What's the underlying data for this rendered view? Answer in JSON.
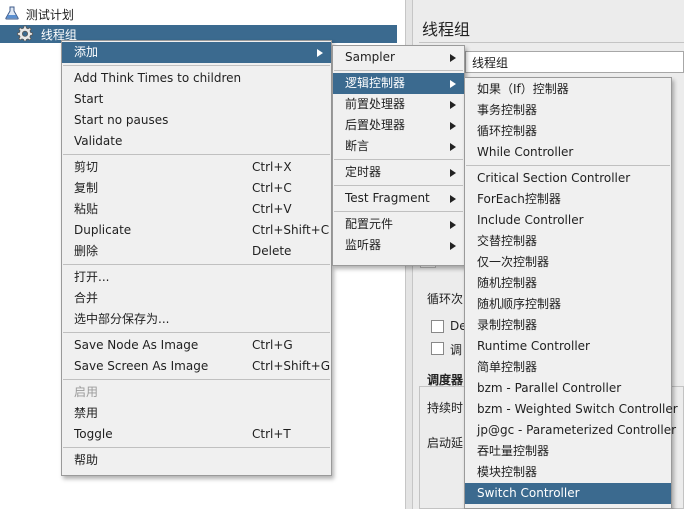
{
  "tree": {
    "test_plan": "测试计划",
    "thread_group": "线程组"
  },
  "editor": {
    "title": "线程组",
    "name_value": "线程组",
    "loop_label": "循环次",
    "check1_label": "De",
    "check2_label": "调",
    "scheduler_label": "调度器",
    "duration_label": "持续时",
    "startup_delay_label": "启动延"
  },
  "context_menu": {
    "items": [
      {
        "label": "添加",
        "submenu": true
      },
      {
        "sep": true
      },
      {
        "label": "Add Think Times to children"
      },
      {
        "label": "Start"
      },
      {
        "label": "Start no pauses"
      },
      {
        "label": "Validate"
      },
      {
        "sep": true
      },
      {
        "label": "剪切",
        "shortcut": "Ctrl+X"
      },
      {
        "label": "复制",
        "shortcut": "Ctrl+C"
      },
      {
        "label": "粘贴",
        "shortcut": "Ctrl+V"
      },
      {
        "label": "Duplicate",
        "shortcut": "Ctrl+Shift+C"
      },
      {
        "label": "删除",
        "shortcut": "Delete"
      },
      {
        "sep": true
      },
      {
        "label": "打开..."
      },
      {
        "label": "合并"
      },
      {
        "label": "选中部分保存为..."
      },
      {
        "sep": true
      },
      {
        "label": "Save Node As Image",
        "shortcut": "Ctrl+G"
      },
      {
        "label": "Save Screen As Image",
        "shortcut": "Ctrl+Shift+G"
      },
      {
        "sep": true
      },
      {
        "label": "启用",
        "disabled": true
      },
      {
        "label": "禁用"
      },
      {
        "label": "Toggle",
        "shortcut": "Ctrl+T"
      },
      {
        "sep": true
      },
      {
        "label": "帮助"
      }
    ]
  },
  "add_submenu": {
    "items": [
      {
        "label": "Sampler"
      },
      {
        "label": "逻辑控制器"
      },
      {
        "label": "前置处理器"
      },
      {
        "label": "后置处理器"
      },
      {
        "label": "断言"
      },
      {
        "label": "定时器"
      },
      {
        "label": "Test Fragment"
      },
      {
        "label": "配置元件"
      },
      {
        "label": "监听器"
      }
    ]
  },
  "logic_submenu": {
    "items": [
      {
        "label": "如果（If）控制器"
      },
      {
        "label": "事务控制器"
      },
      {
        "label": "循环控制器"
      },
      {
        "label": "While Controller"
      },
      {
        "label": "Critical Section Controller"
      },
      {
        "label": "ForEach控制器"
      },
      {
        "label": "Include Controller"
      },
      {
        "label": "交替控制器"
      },
      {
        "label": "仅一次控制器"
      },
      {
        "label": "随机控制器"
      },
      {
        "label": "随机顺序控制器"
      },
      {
        "label": "录制控制器"
      },
      {
        "label": "Runtime Controller"
      },
      {
        "label": "简单控制器"
      },
      {
        "label": "bzm - Parallel Controller"
      },
      {
        "label": "bzm - Weighted Switch Controller"
      },
      {
        "label": "jp@gc - Parameterized Controller"
      },
      {
        "label": "吞吐量控制器"
      },
      {
        "label": "模块控制器"
      },
      {
        "label": "Switch Controller"
      }
    ]
  },
  "colors": {
    "highlight": "#3b6a8f",
    "menu_bg": "#f0f0f0",
    "panel_bg": "#ececec"
  }
}
